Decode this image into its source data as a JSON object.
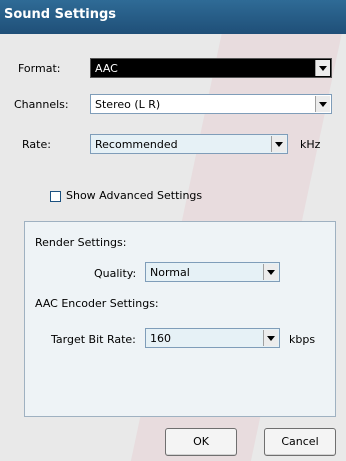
{
  "window": {
    "title": "Sound Settings"
  },
  "format": {
    "label": "Format:",
    "value": "AAC"
  },
  "channels": {
    "label": "Channels:",
    "value": "Stereo (L R)"
  },
  "rate": {
    "label": "Rate:",
    "value": "Recommended",
    "unit": "kHz"
  },
  "advanced": {
    "label": "Show Advanced Settings",
    "checked": false
  },
  "render": {
    "heading": "Render Settings:",
    "quality": {
      "label": "Quality:",
      "value": "Normal"
    }
  },
  "encoder": {
    "heading": "AAC Encoder Settings:",
    "bitrate": {
      "label": "Target Bit Rate:",
      "value": "160",
      "unit": "kbps"
    }
  },
  "buttons": {
    "ok": "OK",
    "cancel": "Cancel"
  },
  "colors": {
    "title_bar": "#2f6b96",
    "format_field": "#000000",
    "highlight_field": "#e6f1f6",
    "panel_bg": "#eef3f6",
    "panel_border": "#9fb1c1"
  }
}
